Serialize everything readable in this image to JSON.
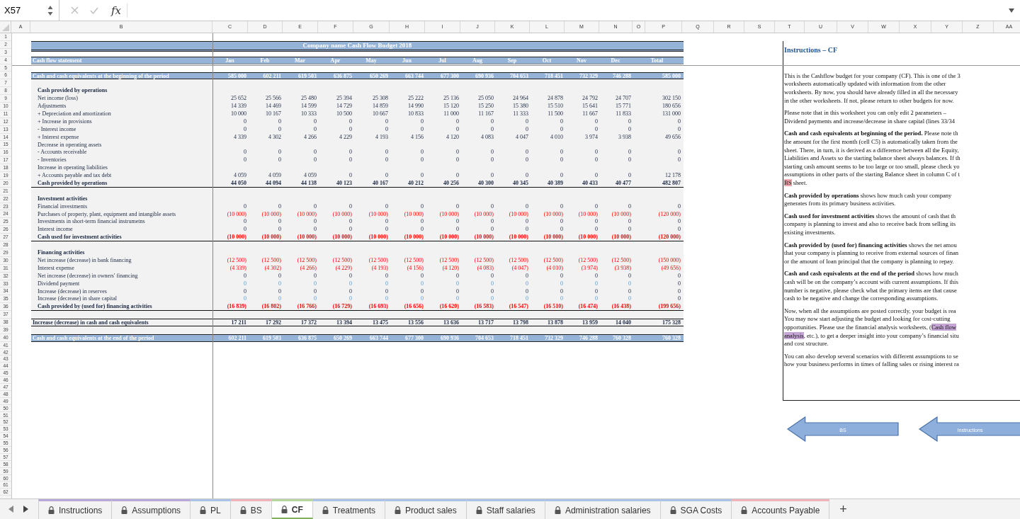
{
  "formula_bar": {
    "cell_ref": "X57",
    "function_label": "fx"
  },
  "column_headers": [
    "A",
    "B",
    "C",
    "D",
    "E",
    "F",
    "G",
    "H",
    "I",
    "J",
    "K",
    "L",
    "M",
    "N",
    "O",
    "P",
    "Q",
    "R",
    "S",
    "T",
    "U",
    "V",
    "W",
    "X",
    "Y",
    "Z",
    "AA"
  ],
  "row_numbers": [
    "1",
    "2",
    "3",
    "4",
    "5",
    "6",
    "7",
    "8",
    "9",
    "10",
    "11",
    "12",
    "13",
    "14",
    "15",
    "16",
    "17",
    "18",
    "19",
    "20",
    "21",
    "22",
    "23",
    "24",
    "25",
    "26",
    "27",
    "28",
    "29",
    "30",
    "31",
    "32",
    "33",
    "34",
    "35",
    "36",
    "37",
    "38",
    "39",
    "40",
    "41",
    "42",
    "43",
    "44",
    "45",
    "46",
    "47",
    "48",
    "49",
    "50",
    "51",
    "52",
    "53",
    "54",
    "55",
    "56",
    "57",
    "58",
    "59",
    "60",
    "61",
    "62"
  ],
  "sheet": {
    "title": "Company name Cash Flow Budget 2018",
    "header_label": "Cash flow statement",
    "months": [
      "Jan",
      "Feb",
      "Mar",
      "Apr",
      "May",
      "Jun",
      "Jul",
      "Aug",
      "Sep",
      "Oct",
      "Nov",
      "Dec",
      "Total"
    ],
    "opening": {
      "label": "Cash and cash equivalents at the beginning of the period",
      "values": [
        "585 000",
        "602 211",
        "619 503",
        "636 875",
        "650 269",
        "663 744",
        "677 300",
        "690 936",
        "704 653",
        "718 451",
        "732 329",
        "746 288",
        "585 000"
      ]
    },
    "rows": [
      {
        "kind": "section",
        "label": "Cash provided by operations"
      },
      {
        "kind": "item",
        "label": "Net income (loss)",
        "negative": false,
        "input": false,
        "values": [
          "25 652",
          "25 566",
          "25 480",
          "25 394",
          "25 308",
          "25 222",
          "25 136",
          "25 050",
          "24 964",
          "24 878",
          "24 792",
          "24 707",
          "302 150"
        ]
      },
      {
        "kind": "item",
        "label": "Adjustments",
        "negative": false,
        "input": false,
        "values": [
          "14 339",
          "14 469",
          "14 599",
          "14 729",
          "14 859",
          "14 990",
          "15 120",
          "15 250",
          "15 380",
          "15 510",
          "15 641",
          "15 771",
          "180 656"
        ]
      },
      {
        "kind": "item",
        "label": "+ Depreciation and amortization",
        "negative": false,
        "input": false,
        "values": [
          "10 000",
          "10 167",
          "10 333",
          "10 500",
          "10 667",
          "10 833",
          "11 000",
          "11 167",
          "11 333",
          "11 500",
          "11 667",
          "11 833",
          "131 000"
        ]
      },
      {
        "kind": "item",
        "label": "+ Increase in provisions",
        "negative": false,
        "input": false,
        "values": [
          "0",
          "0",
          "0",
          "0",
          "0",
          "0",
          "0",
          "0",
          "0",
          "0",
          "0",
          "0",
          "0"
        ]
      },
      {
        "kind": "item",
        "label": "-  Interest income",
        "negative": false,
        "input": false,
        "values": [
          "0",
          "0",
          "0",
          "0",
          "0",
          "0",
          "0",
          "0",
          "0",
          "0",
          "0",
          "0",
          "0"
        ]
      },
      {
        "kind": "item",
        "label": "+ Interest expense",
        "negative": false,
        "input": false,
        "values": [
          "4 339",
          "4 302",
          "4 266",
          "4 229",
          "4 193",
          "4 156",
          "4 120",
          "4 083",
          "4 047",
          "4 010",
          "3 974",
          "3 938",
          "49 656"
        ]
      },
      {
        "kind": "subheading",
        "label": "Decrease in operating assets"
      },
      {
        "kind": "item",
        "label": "-  Accounts receivable",
        "negative": false,
        "input": false,
        "values": [
          "0",
          "0",
          "0",
          "0",
          "0",
          "0",
          "0",
          "0",
          "0",
          "0",
          "0",
          "0",
          "0"
        ]
      },
      {
        "kind": "item",
        "label": "-  Inventories",
        "negative": false,
        "input": false,
        "values": [
          "0",
          "0",
          "0",
          "0",
          "0",
          "0",
          "0",
          "0",
          "0",
          "0",
          "0",
          "0",
          "0"
        ]
      },
      {
        "kind": "subheading",
        "label": "Increase in operating liabilities"
      },
      {
        "kind": "item",
        "label": "+  Accounts payable and tax debt",
        "negative": false,
        "input": false,
        "values": [
          "4 059",
          "4 059",
          "4 059",
          "0",
          "0",
          "0",
          "0",
          "0",
          "0",
          "0",
          "0",
          "0",
          "12 178"
        ]
      },
      {
        "kind": "total",
        "label": "Cash provided by operations",
        "negative": false,
        "input": false,
        "values": [
          "44 050",
          "44 094",
          "44 138",
          "40 123",
          "40 167",
          "40 212",
          "40 256",
          "40 300",
          "40 345",
          "40 389",
          "40 433",
          "40 477",
          "482 807"
        ]
      },
      {
        "kind": "section",
        "label": "Investment activities"
      },
      {
        "kind": "item",
        "label": "Financial investments",
        "negative": false,
        "input": false,
        "values": [
          "0",
          "0",
          "0",
          "0",
          "0",
          "0",
          "0",
          "0",
          "0",
          "0",
          "0",
          "0",
          "0"
        ]
      },
      {
        "kind": "item",
        "label": "Purchases of property, plant, equipment and intangible assets",
        "negative": true,
        "input": false,
        "values": [
          "(10 000)",
          "(10 000)",
          "(10 000)",
          "(10 000)",
          "(10 000)",
          "(10 000)",
          "(10 000)",
          "(10 000)",
          "(10 000)",
          "(10 000)",
          "(10 000)",
          "(10 000)",
          "(120 000)"
        ]
      },
      {
        "kind": "item",
        "label": "Investments in short-term financial instrumetns",
        "negative": false,
        "input": false,
        "values": [
          "0",
          "0",
          "0",
          "0",
          "0",
          "0",
          "0",
          "0",
          "0",
          "0",
          "0",
          "0",
          "0"
        ]
      },
      {
        "kind": "item",
        "label": "Interest income",
        "negative": false,
        "input": false,
        "values": [
          "0",
          "0",
          "0",
          "0",
          "0",
          "0",
          "0",
          "0",
          "0",
          "0",
          "0",
          "0",
          "0"
        ]
      },
      {
        "kind": "total",
        "label": "Cash used for investment activities",
        "negative": true,
        "input": false,
        "values": [
          "(10 000)",
          "(10 000)",
          "(10 000)",
          "(10 000)",
          "(10 000)",
          "(10 000)",
          "(10 000)",
          "(10 000)",
          "(10 000)",
          "(10 000)",
          "(10 000)",
          "(10 000)",
          "(120 000)"
        ]
      },
      {
        "kind": "section",
        "label": "Financing activities"
      },
      {
        "kind": "item",
        "label": "Net increase (decrease) in bank financing",
        "negative": true,
        "input": false,
        "values": [
          "(12 500)",
          "(12 500)",
          "(12 500)",
          "(12 500)",
          "(12 500)",
          "(12 500)",
          "(12 500)",
          "(12 500)",
          "(12 500)",
          "(12 500)",
          "(12 500)",
          "(12 500)",
          "(150 000)"
        ]
      },
      {
        "kind": "item",
        "label": "Interest expense",
        "negative": true,
        "input": false,
        "values": [
          "(4 339)",
          "(4 302)",
          "(4 266)",
          "(4 229)",
          "(4 193)",
          "(4 156)",
          "(4 120)",
          "(4 083)",
          "(4 047)",
          "(4 010)",
          "(3 974)",
          "(3 938)",
          "(49 656)"
        ]
      },
      {
        "kind": "item",
        "label": "Net increase (decrease) in owners' financing",
        "negative": false,
        "input": false,
        "values": [
          "0",
          "0",
          "0",
          "0",
          "0",
          "0",
          "0",
          "0",
          "0",
          "0",
          "0",
          "0",
          "0"
        ]
      },
      {
        "kind": "item",
        "label": "Dividend payment",
        "negative": false,
        "input": true,
        "values": [
          "0",
          "0",
          "0",
          "0",
          "0",
          "0",
          "0",
          "0",
          "0",
          "0",
          "0",
          "0",
          "0"
        ]
      },
      {
        "kind": "item",
        "label": "Increase (decrease) in reserves",
        "negative": false,
        "input": false,
        "values": [
          "0",
          "0",
          "0",
          "0",
          "0",
          "0",
          "0",
          "0",
          "0",
          "0",
          "0",
          "0",
          "0"
        ]
      },
      {
        "kind": "item",
        "label": "Increase (decrease) in share capital",
        "negative": false,
        "input": true,
        "values": [
          "0",
          "0",
          "0",
          "0",
          "0",
          "0",
          "0",
          "0",
          "0",
          "0",
          "0",
          "0",
          "0"
        ]
      },
      {
        "kind": "total",
        "label": "Cash provided by (used for) financing activities",
        "negative": true,
        "input": false,
        "values": [
          "(16 839)",
          "(16 802)",
          "(16 766)",
          "(16 729)",
          "(16 693)",
          "(16 656)",
          "(16 620)",
          "(16 583)",
          "(16 547)",
          "(16 510)",
          "(16 474)",
          "(16 438)",
          "(199 656)"
        ]
      },
      {
        "kind": "net",
        "label": "Increase (decrease) in cash and cash equivalents",
        "negative": false,
        "input": false,
        "values": [
          "17 211",
          "17 292",
          "17 372",
          "13 394",
          "13 475",
          "13 556",
          "13 636",
          "13 717",
          "13 798",
          "13 878",
          "13 959",
          "14 040",
          "175 328"
        ]
      }
    ],
    "closing": {
      "label": "Cash and cash equivalents at the end of the period",
      "values": [
        "602 211",
        "619 503",
        "636 875",
        "650 269",
        "663 744",
        "677 300",
        "690 936",
        "704 653",
        "718 451",
        "732 329",
        "746 288",
        "760 328",
        "760 328"
      ]
    }
  },
  "instructions": {
    "title": "Instructions – CF",
    "paragraphs": [
      {
        "lines": [
          "This is the Cashflow budget for your company (CF). This is one of the 3",
          "worksheets automatically updated with information from the other",
          "worksheets. By now, you should have already filled in all the necessary",
          "in the other worksheets. If not, please return to other budgets for now."
        ]
      },
      {
        "lines": [
          "Please note that in this worksheet you can only edit 2 parameters –",
          "Dividend payments and increase/decrease in share capital (lines 33/34"
        ]
      },
      {
        "lines": [
          "**Cash and cash equivalents at beginning of the period.** Please note th",
          "the amount for the first month (cell C5) is automatically taken from the",
          "sheet. There, in turn, it is derived as a difference between all the Equity,",
          "Liabilities and Assets so the starting balance sheet always balances. If th",
          "starting cash amount seems to be too large or too small, please check yo",
          "assumptions in other parts of the starting Balance sheet in column C of t",
          {
            "link": "BS",
            "after": " sheet.",
            "color": "#f2a7ae"
          }
        ]
      },
      {
        "lines": [
          "**Cash provided by operations** shows how much cash your company",
          "generates from its primary business activities."
        ]
      },
      {
        "lines": [
          "**Cash used for investment activities** shows the amount of cash that th",
          "company is planning to invest and also to receive back from selling its",
          "existing investments."
        ]
      },
      {
        "lines": [
          "**Cash provided by (used for) financing activities** shows the net amou",
          "that your company is planning to receive from external sources of finan",
          "or the amount of loan principal that the company is planning to repay."
        ]
      },
      {
        "lines": [
          "**Cash and cash equivalents at the end of the period** shows how much",
          "cash will be on the company’s account with current assumptions. If this",
          "number is negative, please check what the primary items are that cause",
          "cash to be negative and change the corresponding assumptions."
        ]
      },
      {
        "lines": [
          "Now, when all the assumptions are posted correctly, your budget is rea",
          "You may now start adjusting the budget and looking for cost-cutting",
          {
            "before": "opportunities. Please use the financial analysis worksheets, (",
            "link": "Cash flow",
            "color": "#c6a6d6"
          },
          {
            "link": "analysis",
            "after": ", etc.), to get a deeper insight into your company’s financial situ",
            "color": "#c6a6d6"
          },
          "and cost structure."
        ]
      },
      {
        "lines": [
          "You can also develop several scenarios with different assumptions to se",
          "how your business performs in times of falling sales or rising interest ra"
        ]
      }
    ]
  },
  "nav_buttons": [
    "BS",
    "Instructions"
  ],
  "sheet_tabs": [
    {
      "label": "Instructions",
      "selected": false,
      "color": "#b9a9d9"
    },
    {
      "label": "Assumptions",
      "selected": false,
      "color": "#b9a9d9"
    },
    {
      "label": "PL",
      "selected": false,
      "color": "#a9c4e6"
    },
    {
      "label": "BS",
      "selected": false,
      "color": "#f0b3bb"
    },
    {
      "label": "CF",
      "selected": true,
      "color": "#b7d7a0"
    },
    {
      "label": "Treatments",
      "selected": false,
      "color": "#a9c4e6"
    },
    {
      "label": "Product sales",
      "selected": false,
      "color": "#a9c4e6"
    },
    {
      "label": "Staff salaries",
      "selected": false,
      "color": "#a9c4e6"
    },
    {
      "label": "Administration salaries",
      "selected": false,
      "color": "#a9c4e6"
    },
    {
      "label": "SGA Costs",
      "selected": false,
      "color": "#a9c4e6"
    },
    {
      "label": "Accounts Payable",
      "selected": false,
      "color": "#f0b3bb"
    }
  ],
  "add_tab_label": "+"
}
